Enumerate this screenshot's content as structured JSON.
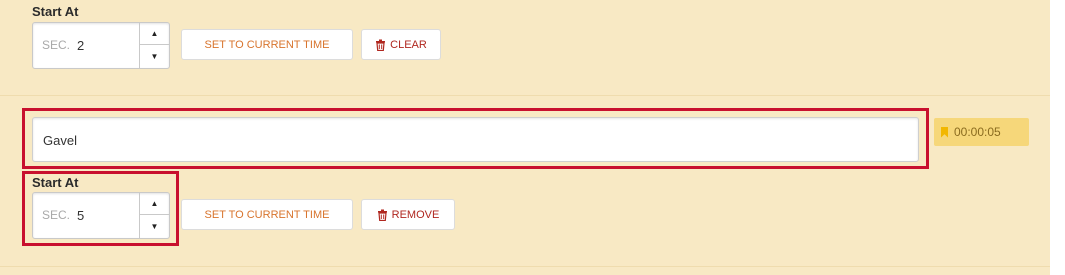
{
  "top_item": {
    "start_label": "Start At",
    "sec_prefix": "SEC.",
    "seconds_value": "2",
    "set_time_label": "SET TO CURRENT TIME",
    "clear_label": "CLEAR"
  },
  "item": {
    "name_value": "Gavel",
    "timestamp": "00:00:05",
    "start_label": "Start At",
    "sec_prefix": "SEC.",
    "seconds_value": "5",
    "set_time_label": "SET TO CURRENT TIME",
    "remove_label": "REMOVE"
  },
  "colors": {
    "panel_bg": "#f8e9c4",
    "highlight": "#c8102e",
    "time_button_text": "#d8742d",
    "danger_text": "#b0271f",
    "badge_bg": "#f6d77a"
  },
  "icons": {
    "spin_up": "caret-up-icon",
    "spin_down": "caret-down-icon",
    "trash": "trash-icon",
    "bookmark": "bookmark-icon"
  }
}
